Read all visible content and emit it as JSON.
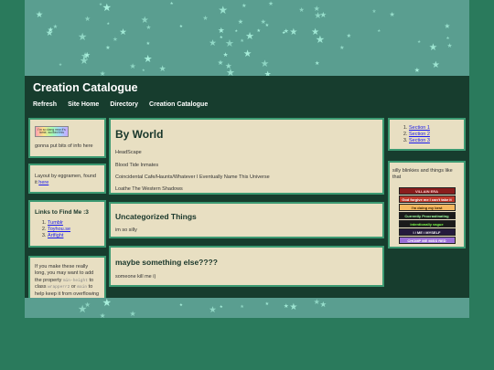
{
  "header": {
    "title": "Creation Catalogue",
    "nav": [
      "Refresh",
      "Site Home",
      "Directory",
      "Creation Catalogue"
    ]
  },
  "left": {
    "box1": {
      "badge_text": "I'm so dang new it's lame, sucked this",
      "text": "gonna put bits of info here"
    },
    "box2": {
      "text": "Layout by eggramen, found it",
      "link": "here"
    },
    "box3": {
      "title": "Links to Find Me :3",
      "links": [
        "Tumblr",
        "Toyhou.se",
        "Artfight"
      ]
    },
    "box4": {
      "p1": "If you make these really long, you may want to add the property",
      "code1": "min-height",
      "p2": "to class",
      "code2": "wrapperr2",
      "p3": "or",
      "code3": "main",
      "p4": "to help keep it from overflowing past the bottom of the page on short pages..."
    }
  },
  "main": {
    "section1": {
      "title": "By World",
      "items": [
        "HeadScape",
        "Blood Tide Inmates",
        "Coincidental Cafe/Haunts/Whatever I Eventually Name This Universe",
        "Loathe The Western Shadows"
      ]
    },
    "section2": {
      "title": "Uncategorized Things",
      "text": "im so silly"
    },
    "section3": {
      "title": "maybe something else????",
      "text": "someone kill me i)"
    }
  },
  "right": {
    "sections": [
      "Section 1",
      "Section 2",
      "Section 3"
    ],
    "blinkies_text": "silly blinkies and things like that",
    "blinkies": [
      {
        "text": "VILLAIN ERA",
        "bg": "#8a1d1d",
        "fg": "#ffd0d0"
      },
      {
        "text": "God forgive me I can't take it",
        "bg": "#c0392b",
        "fg": "#ffffff"
      },
      {
        "text": "I'm doing my best",
        "bg": "#f4b860",
        "fg": "#3a2000"
      },
      {
        "text": "Currently Procrastinating",
        "bg": "#1a1a1a",
        "fg": "#9fffa0"
      },
      {
        "text": "intentionally vague",
        "bg": "#1a1a1a",
        "fg": "#7dff4a"
      },
      {
        "text": "I / ME / MYSELF",
        "bg": "#241a3d",
        "fg": "#ffffff"
      },
      {
        "text": "CHOMP ME MISS RED",
        "bg": "#9a6fd8",
        "fg": "#ffffff"
      }
    ]
  }
}
